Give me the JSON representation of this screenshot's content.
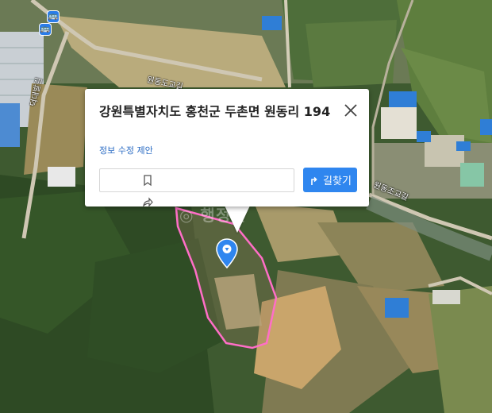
{
  "map": {
    "road_labels": [
      "원동도교길",
      "원동조교길",
      "덕대발길"
    ],
    "bus_stop_glyph": "🚌",
    "marker_color": "#2f86ef",
    "parcel_outline_color": "#ff6ec7",
    "watermark": "◎ 행정안"
  },
  "popup": {
    "title": "강원특별자치도 홍천군 두촌면 원동리 194",
    "suggest_edit": "정보 수정 제안",
    "route_button": "길찾기",
    "close_icon": "close-icon",
    "bookmark_icon": "bookmark-icon",
    "share_icon": "share-icon"
  }
}
